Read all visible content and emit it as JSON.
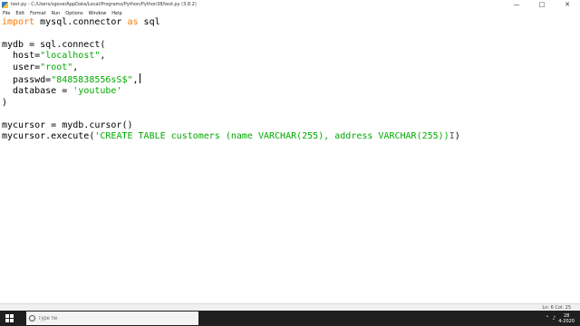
{
  "window": {
    "title": "test.py - C:/Users/sgove/AppData/Local/Programs/Python/Python38/test.py (3.8.2)",
    "minimize_icon": "minimize-icon",
    "maximize_icon": "maximize-icon",
    "close_icon": "close-icon",
    "minimize_glyph": "—",
    "maximize_glyph": "□",
    "close_glyph": "✕"
  },
  "menu": [
    "File",
    "Edit",
    "Format",
    "Run",
    "Options",
    "Window",
    "Help"
  ],
  "code": {
    "line1_kw": "import",
    "line1_mid": " mysql.connector ",
    "line1_kw2": "as",
    "line1_end": " sql",
    "line3": "mydb = sql.connect(",
    "line4_pre": "  host=",
    "line4_str": "\"localhost\"",
    "line4_post": ",",
    "line5_pre": "  user=",
    "line5_str": "\"root\"",
    "line5_post": ",",
    "line6_pre": "  passwd=",
    "line6_str": "\"8485838556sS$\"",
    "line6_post": ",",
    "line7_pre": "  database = ",
    "line7_str": "'youtube'",
    "line8": ")",
    "line10": "mycursor = mydb.cursor()",
    "line11_pre": "mycursor.execute(",
    "line11_str": "'CREATE TABLE customers (name VARCHAR(255), address VARCHAR(255))",
    "line11_post": ")"
  },
  "status": {
    "position": "Ln: 6   Col: 25"
  },
  "taskbar": {
    "search_placeholder": "Type he",
    "clock_time": "28",
    "clock_date": "4-2020"
  },
  "colors": {
    "keyword": "#ff7700",
    "string": "#00aa00",
    "taskbar": "#1f1f1f"
  }
}
